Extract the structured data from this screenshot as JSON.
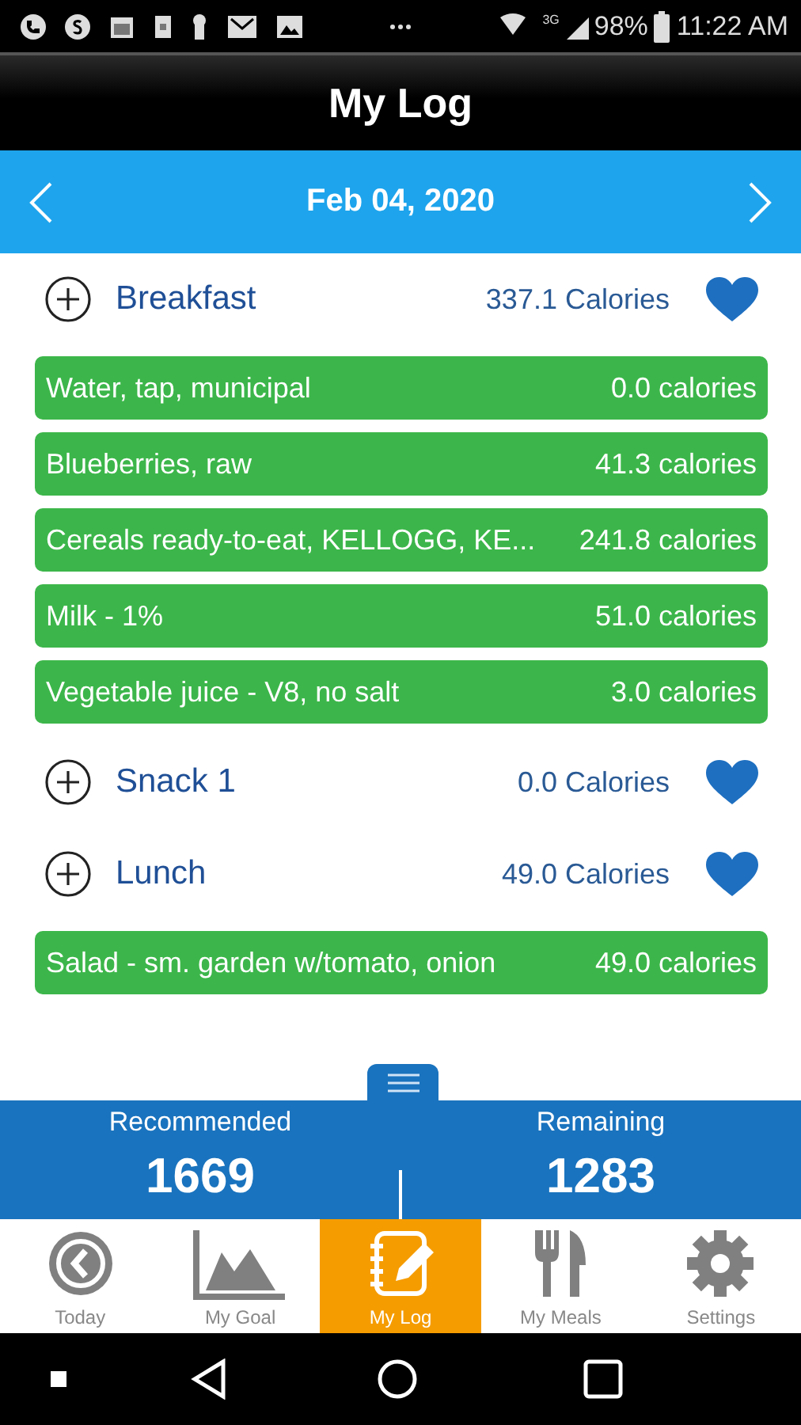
{
  "status_bar": {
    "network": "3G",
    "battery": "98%",
    "time": "11:22 AM"
  },
  "header": {
    "title": "My Log"
  },
  "date_bar": {
    "date": "Feb 04, 2020"
  },
  "meals": [
    {
      "name": "Breakfast",
      "calories": "337.1 Calories",
      "foods": [
        {
          "name": "Water, tap, municipal",
          "calories": "0.0 calories"
        },
        {
          "name": "Blueberries, raw",
          "calories": "41.3 calories"
        },
        {
          "name": "Cereals ready-to-eat, KELLOGG, KE...",
          "calories": "241.8 calories"
        },
        {
          "name": "Milk - 1%",
          "calories": "51.0 calories"
        },
        {
          "name": "Vegetable juice - V8, no salt",
          "calories": "3.0 calories"
        }
      ]
    },
    {
      "name": "Snack 1",
      "calories": "0.0 Calories"
    },
    {
      "name": "Lunch",
      "calories": "49.0 Calories",
      "foods": [
        {
          "name": "Salad - sm. garden w/tomato, onion",
          "calories": "49.0 calories"
        }
      ]
    }
  ],
  "summary": [
    {
      "label": "Recommended",
      "value": "1669"
    },
    {
      "label": "Remaining",
      "value": "1283"
    }
  ],
  "tabs": [
    {
      "kind": "today",
      "label": "Today",
      "selected": false
    },
    {
      "kind": "goal",
      "label": "My Goal",
      "selected": false
    },
    {
      "kind": "log",
      "label": "My Log",
      "selected": true
    },
    {
      "kind": "meals",
      "label": "My Meals",
      "selected": false
    },
    {
      "kind": "settings",
      "label": "Settings",
      "selected": false
    }
  ]
}
